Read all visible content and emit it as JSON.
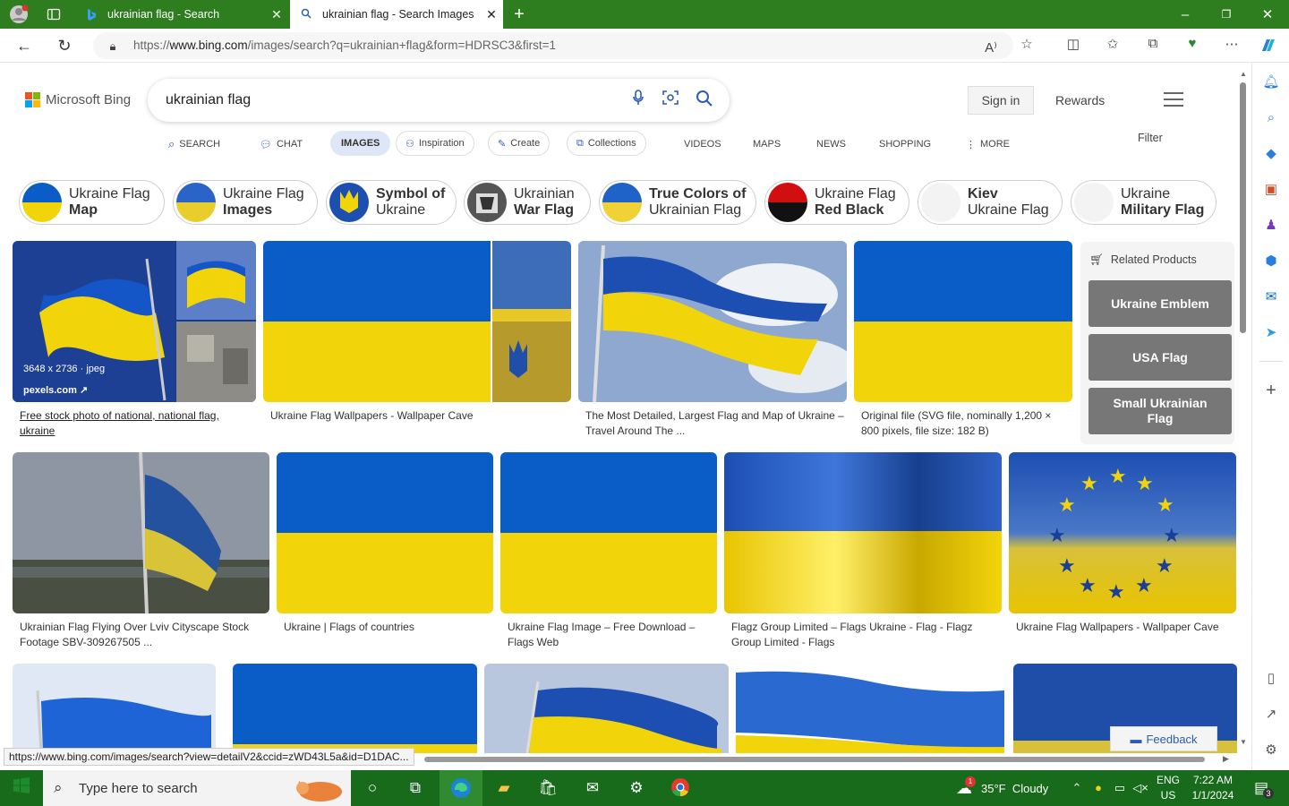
{
  "browser": {
    "tabs": [
      {
        "title": "ukrainian flag - Search"
      },
      {
        "title": "ukrainian flag - Search Images"
      }
    ],
    "url_prefix": "https://",
    "url_host": "www.bing.com",
    "url_path": "/images/search?q=ukrainian+flag&form=HDRSC3&first=1",
    "status_url": "https://www.bing.com/images/search?view=detailV2&ccid=zWD43L5a&id=D1DAC..."
  },
  "bing": {
    "logo_text": "Microsoft Bing",
    "query": "ukrainian flag",
    "sign_in": "Sign in",
    "rewards": "Rewards",
    "filter": "Filter",
    "feedback": "Feedback"
  },
  "nav": [
    {
      "label": "SEARCH"
    },
    {
      "label": "CHAT"
    },
    {
      "label": "IMAGES"
    },
    {
      "label": "Inspiration"
    },
    {
      "label": "Create"
    },
    {
      "label": "Collections"
    },
    {
      "label": "VIDEOS"
    },
    {
      "label": "MAPS"
    },
    {
      "label": "NEWS"
    },
    {
      "label": "SHOPPING"
    },
    {
      "label": "MORE"
    }
  ],
  "chips": [
    {
      "l1": "Ukraine Flag",
      "l2": "Map"
    },
    {
      "l1": "Ukraine Flag",
      "l2": "Images"
    },
    {
      "l1": "Symbol of",
      "l2": "Ukraine"
    },
    {
      "l1": "Ukrainian",
      "l2": "War Flag"
    },
    {
      "l1": "True Colors of",
      "l2": "Ukrainian Flag"
    },
    {
      "l1": "Ukraine Flag",
      "l2": "Red Black"
    },
    {
      "l1": "Kiev",
      "l2": "Ukraine Flag"
    },
    {
      "l1": "Ukraine",
      "l2": "Military Flag"
    }
  ],
  "results": [
    {
      "caption": "Free stock photo of national, national flag, ukraine",
      "meta": "3648 x 2736 · jpeg",
      "source": "pexels.com"
    },
    {
      "caption": "Ukraine Flag Wallpapers - Wallpaper Cave"
    },
    {
      "caption": "The Most Detailed, Largest Flag and Map of Ukraine – Travel Around The ..."
    },
    {
      "caption": "Original file  (SVG file, nominally 1,200 × 800 pixels, file size: 182 B)"
    },
    {
      "caption": "Ukrainian Flag Flying Over Lviv Cityscape Stock Footage SBV-309267505 ..."
    },
    {
      "caption": "Ukraine | Flags of countries"
    },
    {
      "caption": "Ukraine Flag Image – Free Download – Flags Web"
    },
    {
      "caption": "Flagz Group Limited – Flags Ukraine - Flag - Flagz Group Limited - Flags"
    },
    {
      "caption": "Ukraine Flag Wallpapers - Wallpaper Cave"
    }
  ],
  "related": {
    "title": "Related Products",
    "items": [
      "Ukraine Emblem",
      "USA Flag",
      "Small Ukrainian Flag"
    ]
  },
  "taskbar": {
    "search_placeholder": "Type here to search",
    "weather": "35°F  Cloudy",
    "lang1": "ENG",
    "lang2": "US",
    "time": "7:22 AM",
    "date": "1/1/2024",
    "notif_count": "3",
    "weather_badge": "1"
  },
  "colors": {
    "ua_blue": "#0a5cc7",
    "ua_yellow": "#f2d40b",
    "bing_blue": "#2c5bb8"
  }
}
